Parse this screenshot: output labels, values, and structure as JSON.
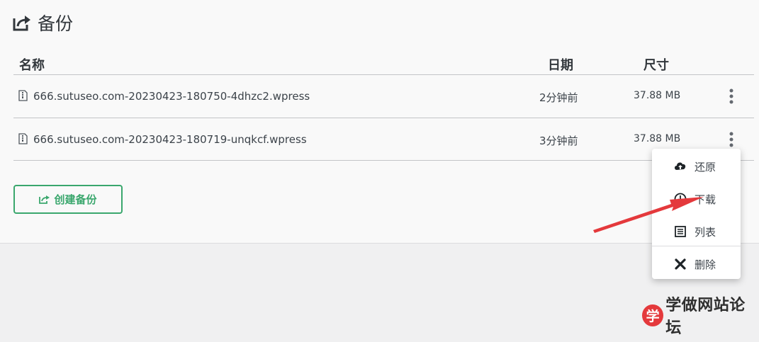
{
  "heading": {
    "title": "备份",
    "icon": "export-icon"
  },
  "table": {
    "columns": {
      "name": "名称",
      "date": "日期",
      "size": "尺寸"
    },
    "rows": [
      {
        "name": "666.sutuseo.com-20230423-180750-4dhzc2.wpress",
        "date": "2分钟前",
        "size": "37.88 MB"
      },
      {
        "name": "666.sutuseo.com-20230423-180719-unqkcf.wpress",
        "date": "3分钟前",
        "size": "37.88 MB"
      }
    ]
  },
  "create_button": {
    "label": "创建备份",
    "icon": "export-icon"
  },
  "context_menu": {
    "items": [
      {
        "label": "还原",
        "icon": "cloud-upload-icon"
      },
      {
        "label": "下载",
        "icon": "download-circle-icon"
      },
      {
        "label": "列表",
        "icon": "list-icon"
      },
      {
        "label": "删除",
        "icon": "close-icon"
      }
    ]
  },
  "watermark": {
    "badge": "学",
    "text": "学做网站论坛"
  },
  "colors": {
    "accent": "#3aa76d",
    "annotation_arrow": "#e4393c",
    "panel_bg": "#f9f9f9",
    "page_bg": "#f0f0f1"
  }
}
